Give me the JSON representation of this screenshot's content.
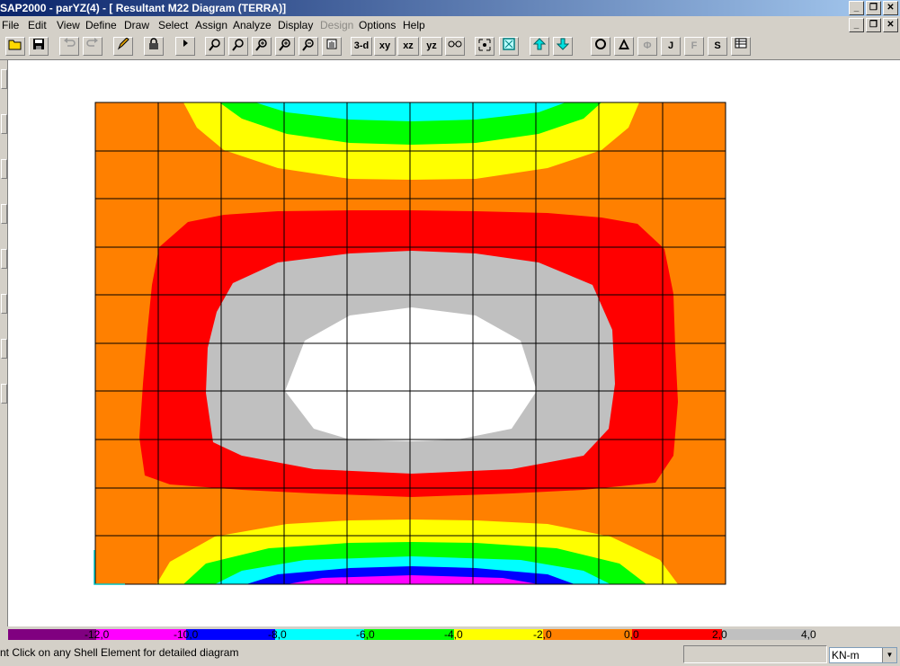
{
  "window": {
    "title": "SAP2000 - parYZ(4) - [  Resultant M22 Diagram   (TERRA)]",
    "min_glyph": "_",
    "max_glyph": "❐",
    "close_glyph": "✕"
  },
  "menu": [
    "File",
    "Edit",
    "View",
    "Define",
    "Draw",
    "Select",
    "Assign",
    "Analyze",
    "Display",
    "Design",
    "Options",
    "Help"
  ],
  "menu_disabled": [
    "Design"
  ],
  "toolbar": {
    "view_3d": "3-d",
    "view_xy": "xy",
    "view_xz": "xz",
    "view_yz": "yz",
    "icons": [
      "open-icon",
      "save-icon",
      "undo-icon",
      "redo-icon",
      "pencil-icon",
      "lock-icon",
      "run-icon",
      "zoom-window-icon",
      "zoom-in-icon",
      "zoom-restore-icon",
      "zoom-in-step-icon",
      "zoom-out-step-icon",
      "pan-hand-icon",
      "perspective-icon",
      "element-select-icon",
      "element-box-icon",
      "up-arrow-icon",
      "down-arrow-icon",
      "o-icon",
      "triangle-icon",
      "phi-icon",
      "j-icon",
      "f-icon",
      "s-icon",
      "table-icon"
    ],
    "glyph_j": "J",
    "glyph_f": "F",
    "glyph_s": "S",
    "glyph_phi": "Φ"
  },
  "legend": {
    "labels": [
      "-12,0",
      "-10,0",
      "-8,0",
      "-6,0",
      "-4,0",
      "-2,0",
      "0,0",
      "2,0",
      "4,0"
    ],
    "colors": [
      "#800080",
      "#ff00ff",
      "#0000ff",
      "#00ffff",
      "#00ff00",
      "#ffff00",
      "#ff8000",
      "#ff0000",
      "#c0c0c0"
    ]
  },
  "contour_colors": {
    "orange": "#ff8000",
    "yellow": "#ffff00",
    "green": "#00ff00",
    "cyan": "#00ffff",
    "blue": "#0000ff",
    "magenta": "#ff00ff",
    "red": "#ff0000",
    "gray": "#c0c0c0",
    "white": "#ffffff"
  },
  "status": {
    "message": "nt Click on any Shell Element for detailed diagram",
    "units": "KN-m"
  }
}
